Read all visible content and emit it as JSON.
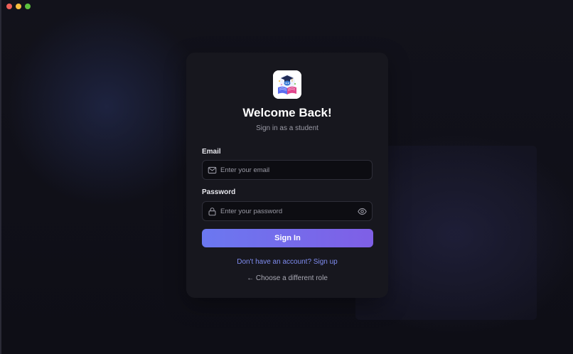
{
  "window": {
    "controls": [
      "close",
      "minimize",
      "zoom"
    ]
  },
  "login": {
    "title": "Welcome Back!",
    "subtitle": "Sign in as a student",
    "email": {
      "label": "Email",
      "placeholder": "Enter your email",
      "value": "",
      "icon": "mail-icon"
    },
    "password": {
      "label": "Password",
      "placeholder": "Enter your password",
      "value": "",
      "icon": "lock-icon",
      "toggle_icon": "eye-icon"
    },
    "submit_label": "Sign In",
    "signup_link": "Don't have an account? Sign up",
    "role_link": "← Choose a different role"
  },
  "colors": {
    "accent_start": "#6b78f0",
    "accent_end": "#7f5fe6",
    "link": "#7f8cf0",
    "card": "#17171e",
    "background": "#0f0f17"
  }
}
